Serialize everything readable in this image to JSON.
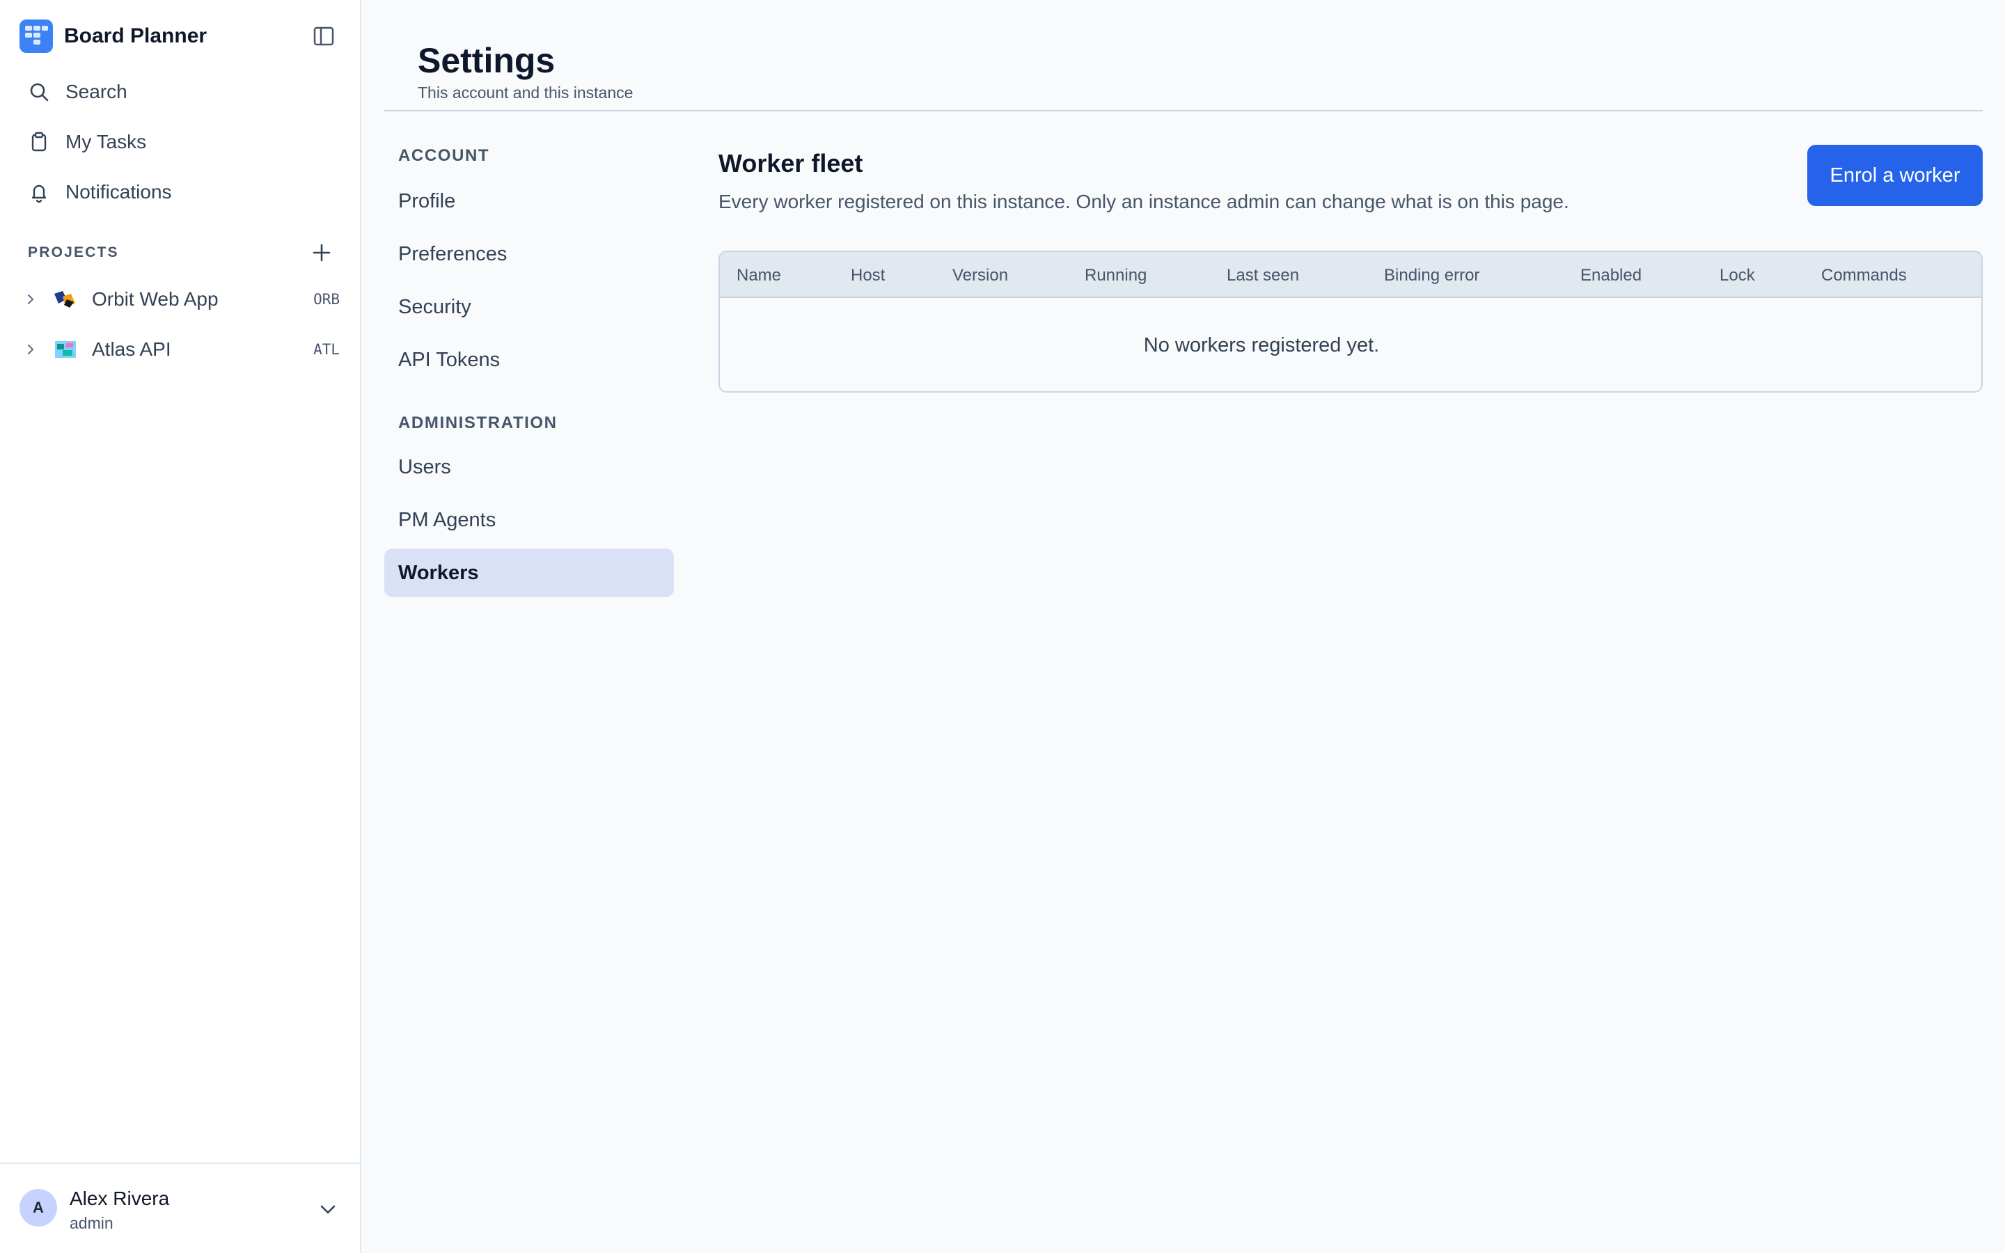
{
  "app": {
    "name": "Board Planner"
  },
  "sidebar": {
    "nav": [
      {
        "label": "Search",
        "icon": "search-icon"
      },
      {
        "label": "My Tasks",
        "icon": "clipboard-icon"
      },
      {
        "label": "Notifications",
        "icon": "bell-icon"
      }
    ],
    "projects_heading": "PROJECTS",
    "projects": [
      {
        "name": "Orbit Web App",
        "key": "ORB"
      },
      {
        "name": "Atlas API",
        "key": "ATL"
      }
    ],
    "user": {
      "initial": "A",
      "name": "Alex Rivera",
      "role": "admin"
    }
  },
  "page": {
    "title": "Settings",
    "subtitle": "This account and this instance"
  },
  "settings_nav": {
    "account_heading": "ACCOUNT",
    "account_items": [
      "Profile",
      "Preferences",
      "Security",
      "API Tokens"
    ],
    "admin_heading": "ADMINISTRATION",
    "admin_items": [
      "Users",
      "PM Agents",
      "Workers"
    ],
    "active": "Workers"
  },
  "worker_fleet": {
    "title": "Worker fleet",
    "description": "Every worker registered on this instance. Only an instance admin can change what is on this page.",
    "enrol_label": "Enrol a worker",
    "columns": [
      "Name",
      "Host",
      "Version",
      "Running",
      "Last seen",
      "Binding error",
      "Enabled",
      "Lock",
      "Commands"
    ],
    "empty_message": "No workers registered yet."
  },
  "colors": {
    "accent": "#2563eb",
    "active_nav_bg": "#d9e1f7",
    "logo": "#3b82f6"
  }
}
